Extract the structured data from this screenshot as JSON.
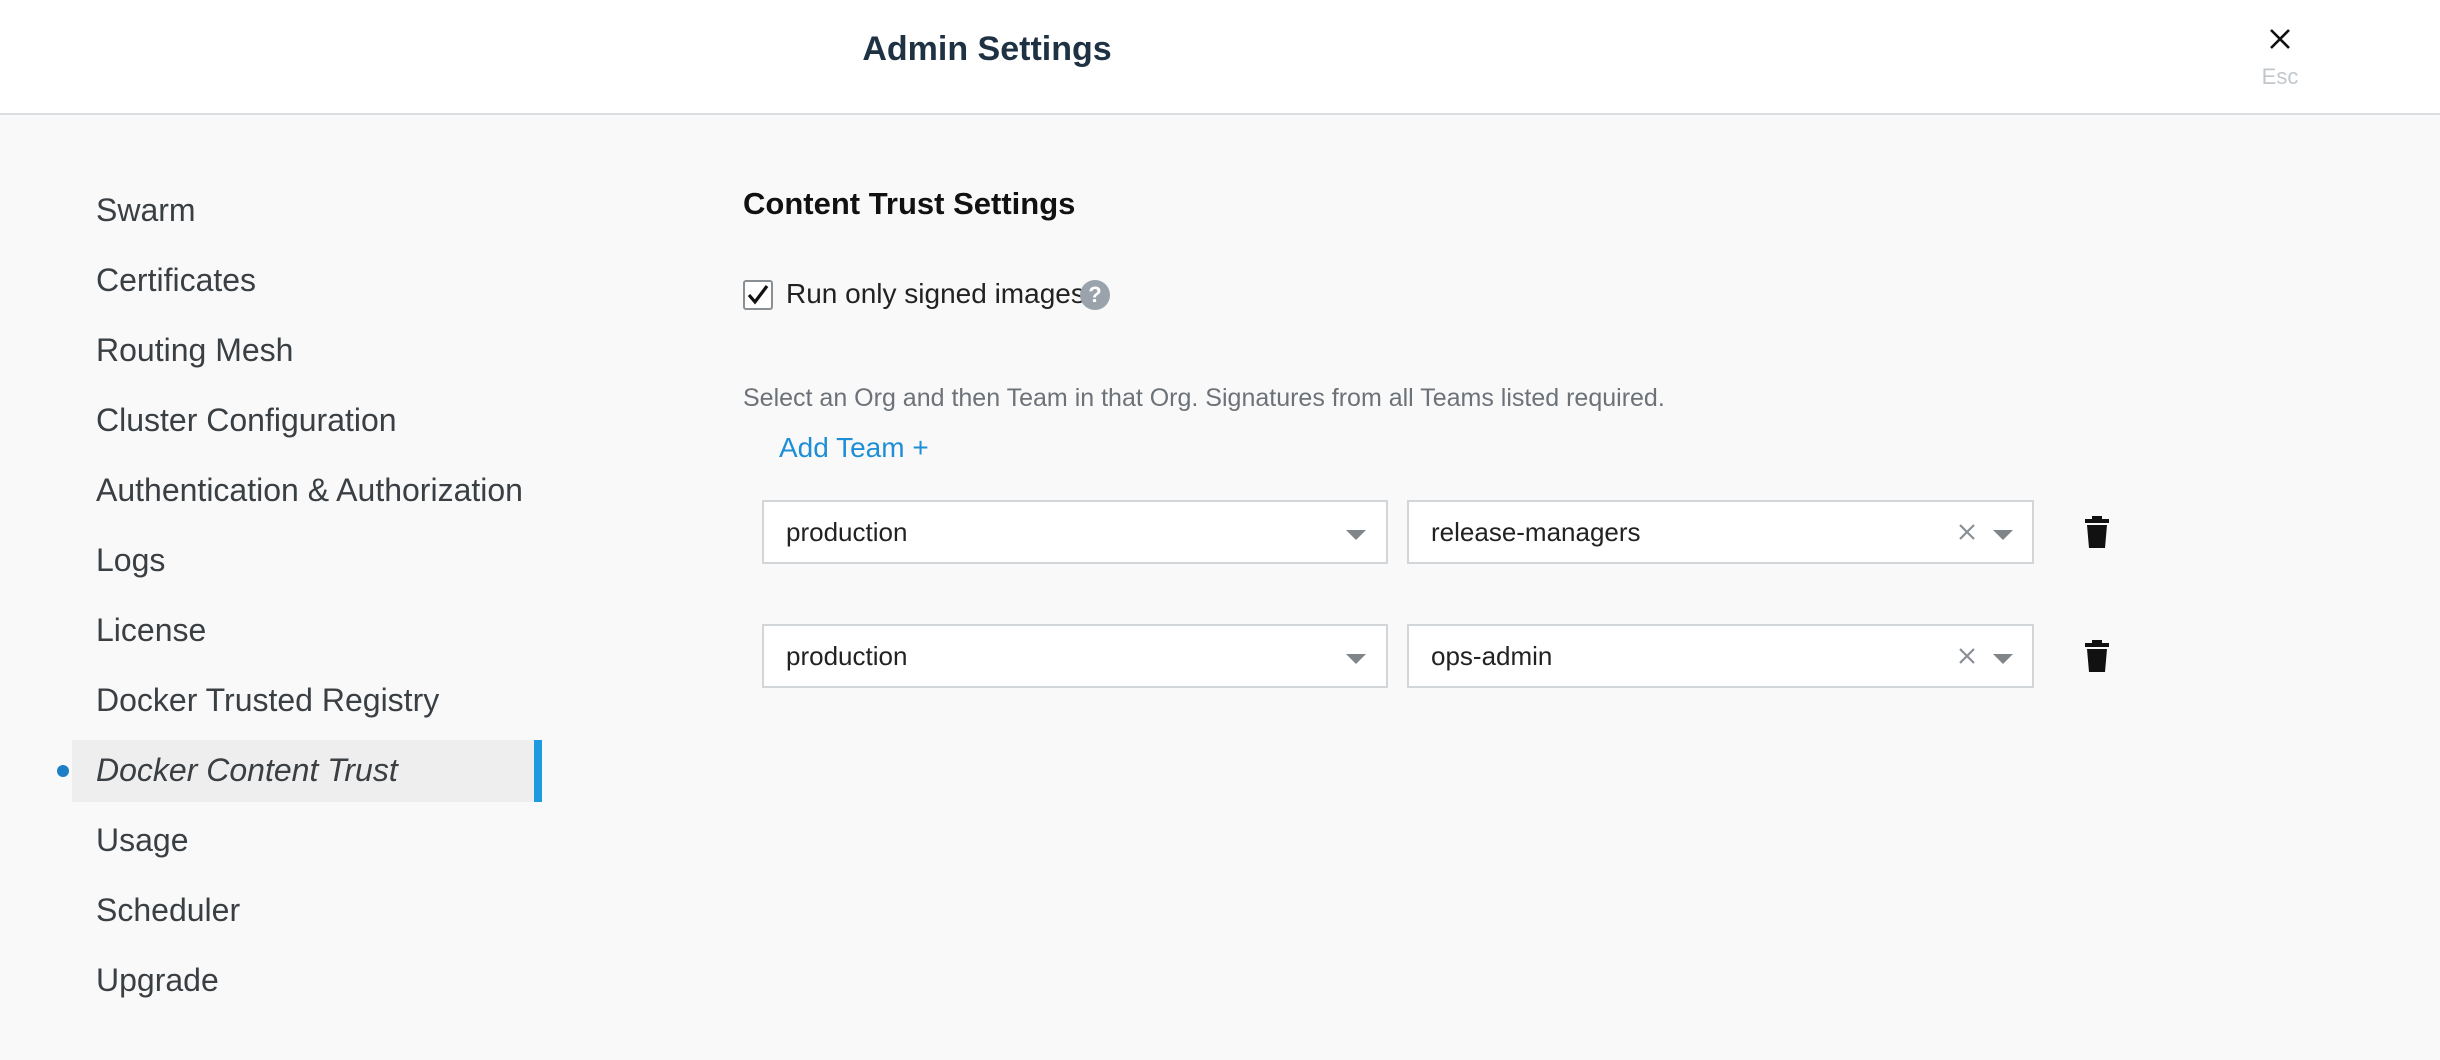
{
  "header": {
    "title": "Admin Settings",
    "close_hint": "Esc"
  },
  "sidebar": {
    "items": [
      {
        "label": "Swarm"
      },
      {
        "label": "Certificates"
      },
      {
        "label": "Routing Mesh"
      },
      {
        "label": "Cluster Configuration"
      },
      {
        "label": "Authentication & Authorization"
      },
      {
        "label": "Logs"
      },
      {
        "label": "License"
      },
      {
        "label": "Docker Trusted Registry"
      },
      {
        "label": "Docker Content Trust",
        "active": true
      },
      {
        "label": "Usage"
      },
      {
        "label": "Scheduler"
      },
      {
        "label": "Upgrade"
      }
    ]
  },
  "content": {
    "title": "Content Trust Settings",
    "checkbox": {
      "label": "Run only signed images",
      "checked": true,
      "help": "?"
    },
    "hint": "Select an Org and then Team in that Org. Signatures from all Teams listed required.",
    "add_team_label": "Add Team +",
    "teams": [
      {
        "org": "production",
        "team": "release-managers"
      },
      {
        "org": "production",
        "team": "ops-admin"
      }
    ]
  },
  "colors": {
    "accent": "#1e9be0",
    "link": "#1e8fd6",
    "title": "#1f3244"
  },
  "icons": [
    "close-icon",
    "check-icon",
    "help-icon",
    "chevron-down-icon",
    "clear-icon",
    "trash-icon"
  ]
}
